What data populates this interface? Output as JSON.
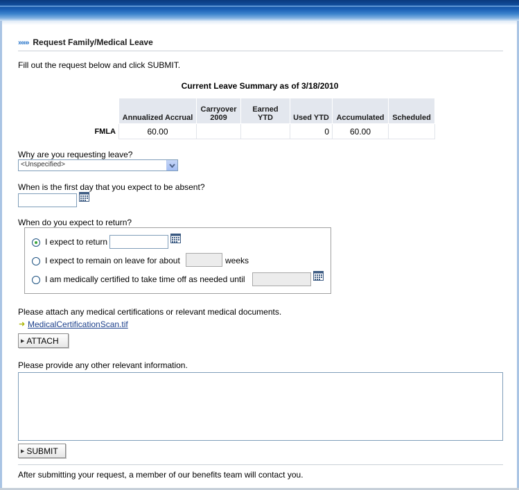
{
  "page": {
    "title": "Request Family/Medical Leave",
    "title_arrows": "»»»",
    "intro": "Fill out the request below and click SUBMIT."
  },
  "summary": {
    "title": "Current Leave Summary as of 3/18/2010",
    "columns": [
      "Annualized Accrual",
      "Carryover 2009",
      "Earned YTD",
      "Used YTD",
      "Accumulated",
      "Scheduled"
    ],
    "rows": [
      {
        "label": "FMLA",
        "values": [
          "60.00",
          "",
          "",
          "0",
          "60.00",
          ""
        ]
      }
    ]
  },
  "reason": {
    "question": "Why are you requesting leave?",
    "selected": "<Unspecified>"
  },
  "first_day": {
    "question": "When is the first day that you expect to be absent?",
    "value": ""
  },
  "return": {
    "question": "When do you expect to return?",
    "options": [
      {
        "label": "I expect to return",
        "checked": true
      },
      {
        "label": "I expect to remain on leave for about",
        "suffix": "weeks",
        "checked": false
      },
      {
        "label": "I am medically certified to take time off as needed until",
        "checked": false
      }
    ]
  },
  "attachments": {
    "prompt": "Please attach any medical certifications or relevant medical documents.",
    "files": [
      "MedicalCertificationScan.tif"
    ],
    "attach_label": "ATTACH"
  },
  "other_info": {
    "prompt": "Please provide any other relevant information.",
    "value": ""
  },
  "submit_label": "SUBMIT",
  "footer_note": "After submitting your request, a member of our benefits team will contact you.",
  "colors": {
    "accent": "#1f6fc7",
    "link": "#1b3f8b",
    "header_bg": "#e3e7ee",
    "radio_selected": "#3aa63a"
  }
}
